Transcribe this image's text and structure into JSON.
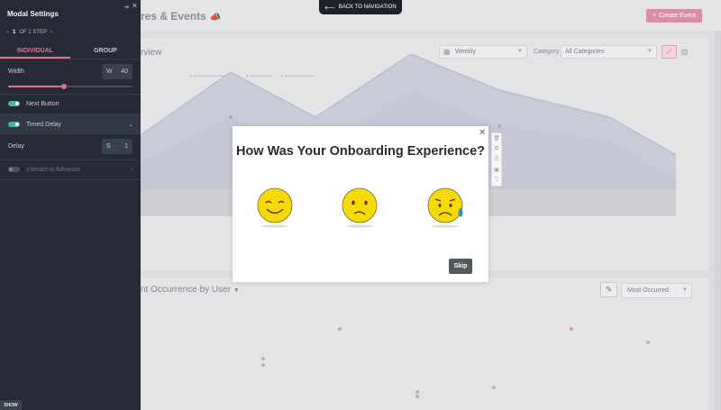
{
  "app": {
    "page_title": "res & Events",
    "create_button": "Create Event",
    "create_icon": "plus-icon",
    "card1": {
      "title": "rview",
      "period_select": "Weekly",
      "category_label": "Category",
      "category_select": "All Categories"
    },
    "card2": {
      "title": "nt Occurrence by User",
      "sort_select": "Most Occurred"
    }
  },
  "nav": {
    "back_label": "BACK TO NAVIGATION"
  },
  "panel": {
    "title": "Modal Settings",
    "stepper": {
      "current": "1",
      "total_text": "OF 1 STEP"
    },
    "tabs": [
      {
        "label": "INDIVIDUAL",
        "active": true
      },
      {
        "label": "GROUP",
        "active": false
      }
    ],
    "width": {
      "label": "Width",
      "unit": "W",
      "value": "40",
      "slider_fraction": 0.45
    },
    "next_button": {
      "label": "Next Button",
      "enabled": true
    },
    "timed_delay": {
      "label": "Timed Delay",
      "enabled": true
    },
    "delay": {
      "label": "Delay",
      "unit": "S",
      "value": "1"
    },
    "interact": {
      "label": "Interact to Advance",
      "enabled": false
    },
    "show_label": "SHOW"
  },
  "modal": {
    "title": "How Was Your Onboarding Experience?",
    "options": [
      {
        "icon": "happy-face-icon"
      },
      {
        "icon": "neutral-face-icon"
      },
      {
        "icon": "sad-face-icon"
      }
    ],
    "skip_label": "Skip"
  },
  "colors": {
    "accent": "#e4708f",
    "toggle_on": "#3fb98f",
    "panel_bg": "#252a36",
    "emoji_yellow": "#f5d90a"
  }
}
